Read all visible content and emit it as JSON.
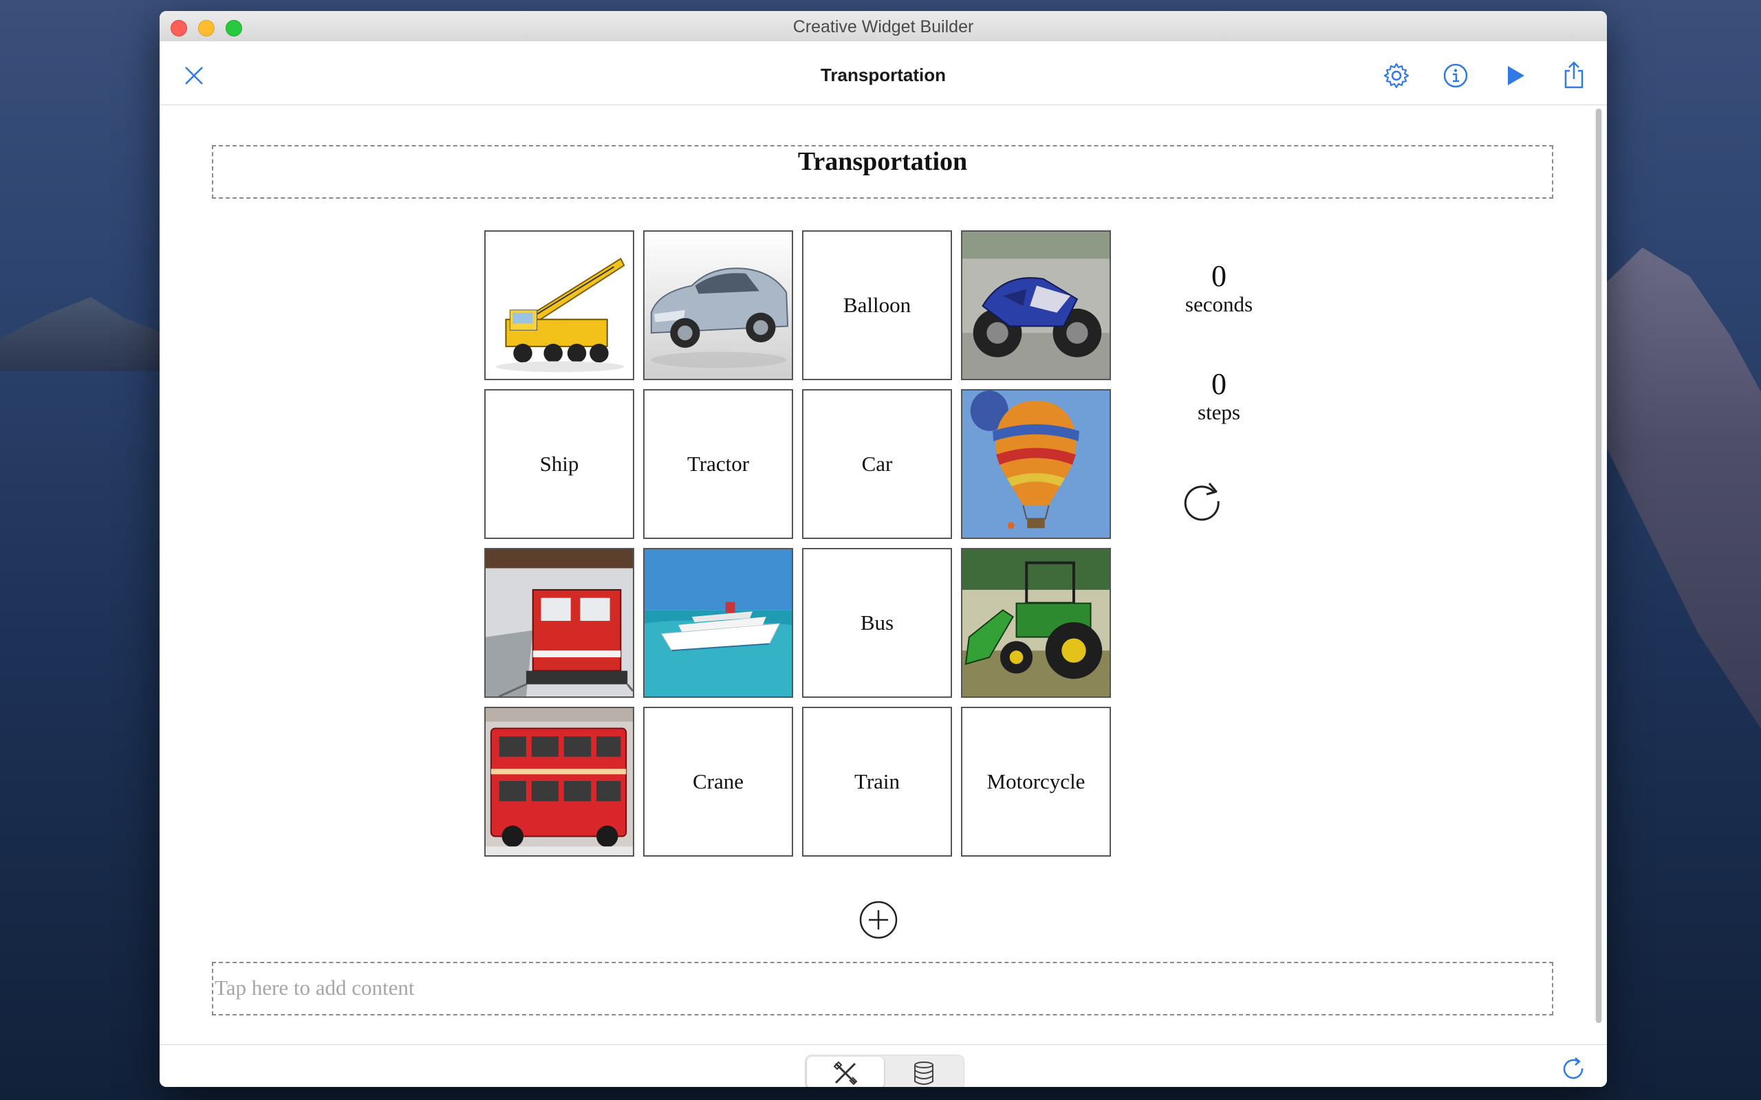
{
  "window": {
    "title": "Creative Widget Builder"
  },
  "toolbar": {
    "title": "Transportation"
  },
  "widget": {
    "title": "Transportation",
    "cells": [
      {
        "type": "image",
        "name": "crane"
      },
      {
        "type": "image",
        "name": "car"
      },
      {
        "type": "text",
        "label": "Balloon"
      },
      {
        "type": "image",
        "name": "motorcycle"
      },
      {
        "type": "text",
        "label": "Ship"
      },
      {
        "type": "text",
        "label": "Tractor"
      },
      {
        "type": "text",
        "label": "Car"
      },
      {
        "type": "image",
        "name": "balloon"
      },
      {
        "type": "image",
        "name": "train"
      },
      {
        "type": "image",
        "name": "ship"
      },
      {
        "type": "text",
        "label": "Bus"
      },
      {
        "type": "image",
        "name": "tractor"
      },
      {
        "type": "image",
        "name": "bus"
      },
      {
        "type": "text",
        "label": "Crane"
      },
      {
        "type": "text",
        "label": "Train"
      },
      {
        "type": "text",
        "label": "Motorcycle"
      }
    ],
    "stats": {
      "seconds_value": "0",
      "seconds_label": "seconds",
      "steps_value": "0",
      "steps_label": "steps"
    },
    "footer_placeholder": "Tap here to add content"
  },
  "colors": {
    "accent": "#2f7ae5",
    "cell_border": "#555555"
  }
}
